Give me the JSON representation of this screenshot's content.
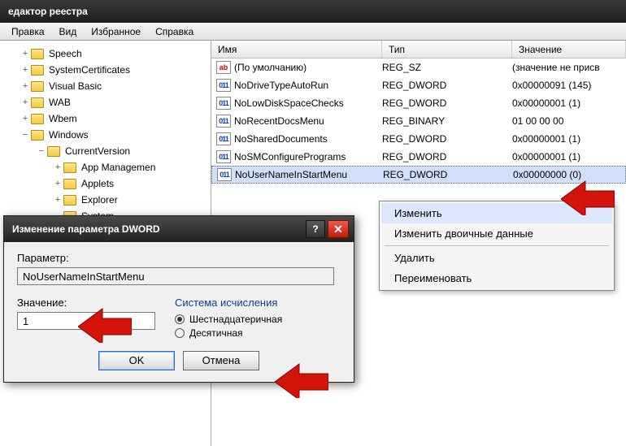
{
  "window": {
    "title": "едактор реестра"
  },
  "menu": {
    "items": [
      "Правка",
      "Вид",
      "Избранное",
      "Справка"
    ]
  },
  "tree": [
    {
      "indent": 1,
      "exp": "+",
      "label": "Speech"
    },
    {
      "indent": 1,
      "exp": "+",
      "label": "SystemCertificates"
    },
    {
      "indent": 1,
      "exp": "+",
      "label": "Visual Basic"
    },
    {
      "indent": 1,
      "exp": "+",
      "label": "WAB"
    },
    {
      "indent": 1,
      "exp": "+",
      "label": "Wbem"
    },
    {
      "indent": 1,
      "exp": "−",
      "label": "Windows"
    },
    {
      "indent": 2,
      "exp": "−",
      "label": "CurrentVersion"
    },
    {
      "indent": 3,
      "exp": "+",
      "label": "App Managemen"
    },
    {
      "indent": 3,
      "exp": "+",
      "label": "Applets"
    },
    {
      "indent": 3,
      "exp": "+",
      "label": "Explorer"
    },
    {
      "indent": 3,
      "exp": "",
      "label": "System"
    }
  ],
  "columns": {
    "c1": "Имя",
    "c2": "Тип",
    "c3": "Значение"
  },
  "rows": [
    {
      "icon": "ab",
      "name": "(По умолчанию)",
      "type": "REG_SZ",
      "value": "(значение не присв",
      "sel": false
    },
    {
      "icon": "bin",
      "name": "NoDriveTypeAutoRun",
      "type": "REG_DWORD",
      "value": "0x00000091 (145)",
      "sel": false
    },
    {
      "icon": "bin",
      "name": "NoLowDiskSpaceChecks",
      "type": "REG_DWORD",
      "value": "0x00000001 (1)",
      "sel": false
    },
    {
      "icon": "bin",
      "name": "NoRecentDocsMenu",
      "type": "REG_BINARY",
      "value": "01 00 00 00",
      "sel": false
    },
    {
      "icon": "bin",
      "name": "NoSharedDocuments",
      "type": "REG_DWORD",
      "value": "0x00000001 (1)",
      "sel": false
    },
    {
      "icon": "bin",
      "name": "NoSMConfigurePrograms",
      "type": "REG_DWORD",
      "value": "0x00000001 (1)",
      "sel": false
    },
    {
      "icon": "bin",
      "name": "NoUserNameInStartMenu",
      "type": "REG_DWORD",
      "value": "0x00000000 (0)",
      "sel": true
    }
  ],
  "context_menu": {
    "items": [
      "Изменить",
      "Изменить двоичные данные",
      "-",
      "Удалить",
      "Переименовать"
    ],
    "highlighted": 0
  },
  "dialog": {
    "title": "Изменение параметра DWORD",
    "param_label": "Параметр:",
    "param_value": "NoUserNameInStartMenu",
    "value_label": "Значение:",
    "value_value": "1",
    "group_label": "Система исчисления",
    "radix_hex": "Шестнадцатеричная",
    "radix_dec": "Десятичная",
    "radix_selected": "hex",
    "ok": "OK",
    "cancel": "Отмена"
  },
  "colors": {
    "accent": "#c61b0b",
    "arrow": "#d4140a"
  }
}
